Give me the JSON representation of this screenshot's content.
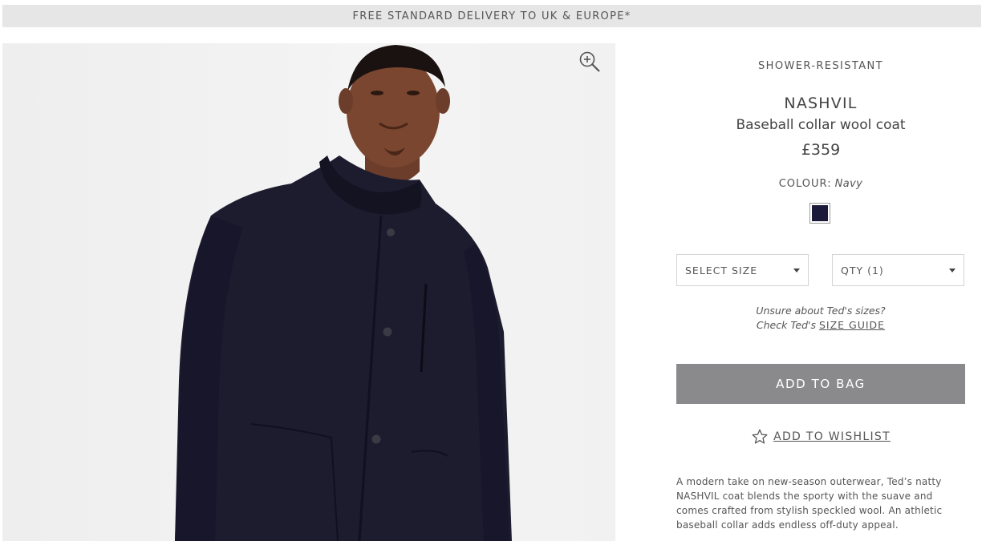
{
  "banner": {
    "text": "FREE STANDARD DELIVERY TO UK & EUROPE*"
  },
  "gallery": {
    "zoom_icon": "zoom-in-icon"
  },
  "product": {
    "feature": "SHOWER-RESISTANT",
    "name": "NASHVIL",
    "subtitle": "Baseball collar wool coat",
    "price": "£359",
    "colour_label": "COLOUR:",
    "colour_value": "Navy",
    "swatch_color": "#1b1a3a"
  },
  "options": {
    "size_label": "SELECT SIZE",
    "qty_label": "QTY (1)"
  },
  "size_help": {
    "line1": "Unsure about Ted's sizes?",
    "line2": "Check Ted's",
    "link": "SIZE GUIDE"
  },
  "actions": {
    "add_to_bag": "ADD TO BAG",
    "add_to_wishlist": "ADD TO WISHLIST",
    "wishlist_icon": "star-outline-icon"
  },
  "description": "A modern take on new-season outerwear, Ted’s natty NASHVIL coat blends the sporty with the suave and comes crafted from stylish speckled wool. An athletic baseball collar adds endless off-duty appeal.",
  "colors": {
    "bag_button": "#8a8a8c",
    "banner_bg": "#e5e6e5",
    "coat": "#1d1b2e"
  }
}
